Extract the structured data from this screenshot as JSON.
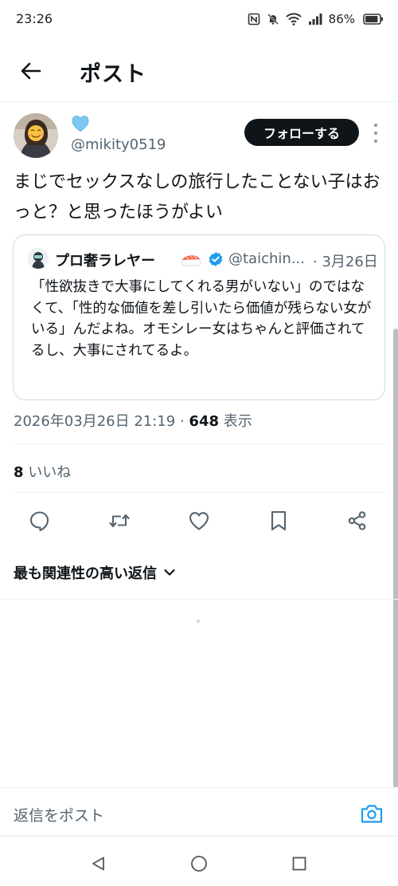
{
  "status_bar": {
    "time": "23:26",
    "battery": "86%"
  },
  "header": {
    "title": "ポスト"
  },
  "post": {
    "author_name": "💙",
    "author_handle": "@mikity0519",
    "follow_label": "フォローする",
    "text": "まじでセックスなしの旅行したことない子はおっと？と思ったほうがよい",
    "timestamp": "2026年03月26日 21:19",
    "separator": "·",
    "views_count": "648",
    "views_label": "表示",
    "likes_count": "8",
    "likes_label": "いいね"
  },
  "quote": {
    "author_name": "プロ奢ラレヤー",
    "author_handle": "@taichin...",
    "date": "· 3月26日",
    "text": "「性欲抜きで大事にしてくれる男がいない」のではなくて、「性的な価値を差し引いたら価値が残らない女がいる」んだよね。オモシレー女はちゃんと評価されてるし、大事にされてるよ。"
  },
  "replies": {
    "sort_label": "最も関連性の高い返信"
  },
  "reply_bar": {
    "placeholder": "返信をポスト"
  },
  "icons": {
    "back": "arrow-left-icon",
    "more": "more-vertical-icon",
    "reply": "comment-icon",
    "retweet": "repost-icon",
    "like": "heart-icon",
    "bookmark": "bookmark-icon",
    "share": "share-icon",
    "camera": "camera-icon",
    "verified": "verified-badge-icon",
    "sushi": "sushi-emoji-icon"
  },
  "colors": {
    "text": "#0f1419",
    "secondary": "#536471",
    "accent": "#1d9bf0",
    "follow_bg": "#0f1419",
    "border": "#cfd9de"
  }
}
